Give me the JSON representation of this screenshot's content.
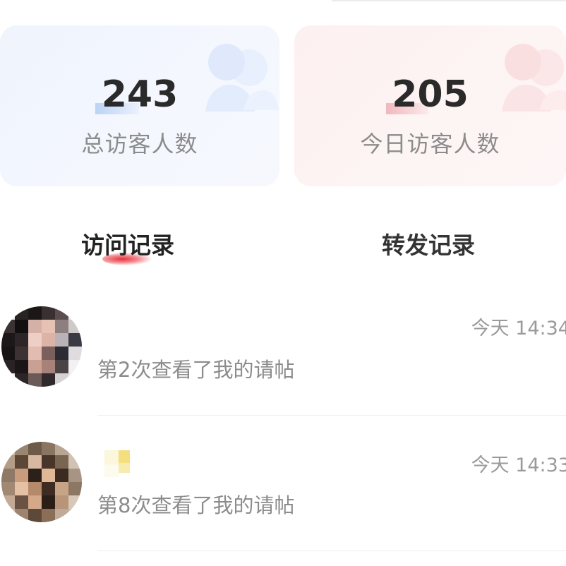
{
  "stats": {
    "total": {
      "value": "243",
      "label": "总访客人数"
    },
    "today": {
      "value": "205",
      "label": "今日访客人数"
    }
  },
  "tabs": [
    {
      "label": "访问记录",
      "active": true
    },
    {
      "label": "转发记录",
      "active": false
    }
  ],
  "visitors": [
    {
      "time": "今天 14:34",
      "action": "第2次查看了我的请帖"
    },
    {
      "time": "今天 14:33",
      "action": "第8次查看了我的请帖"
    }
  ],
  "colors": {
    "accent": "#e8323c",
    "total_card_bg": "#f1f5fd",
    "today_card_bg": "#fdf2f2",
    "muted_text": "#8c8c8c"
  },
  "icons": {
    "total_card": "visitors-icon",
    "today_card": "visitors-icon"
  }
}
